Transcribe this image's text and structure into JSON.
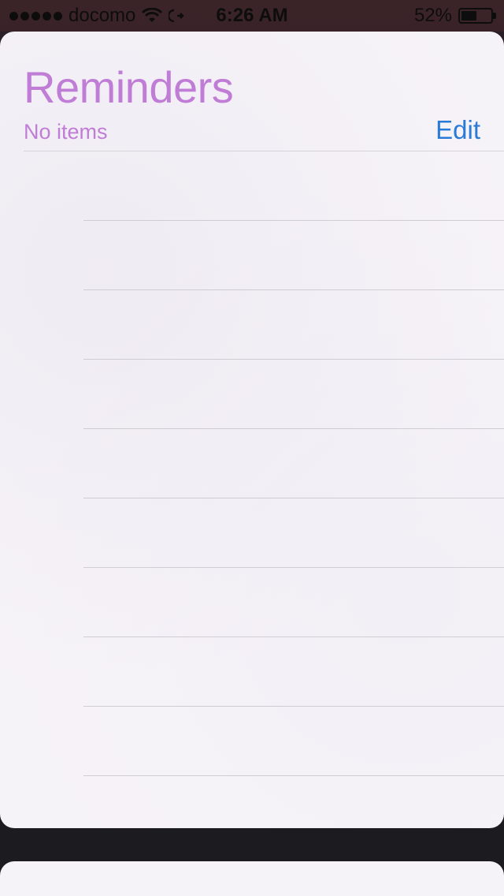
{
  "status_bar": {
    "carrier": "docomo",
    "time": "6:26 AM",
    "battery_percent_label": "52%",
    "battery_level": 0.52,
    "signal_icon": "signal-dots-icon",
    "wifi_icon": "wifi-icon",
    "sync_icon": "sync-icon",
    "battery_icon": "battery-icon"
  },
  "reminders": {
    "title": "Reminders",
    "subtitle": "No items",
    "edit_label": "Edit"
  },
  "colors": {
    "title": "#c07dd6",
    "edit": "#2a7bd8",
    "card_background": "#f6f3f8",
    "background": "#1c1c20"
  }
}
